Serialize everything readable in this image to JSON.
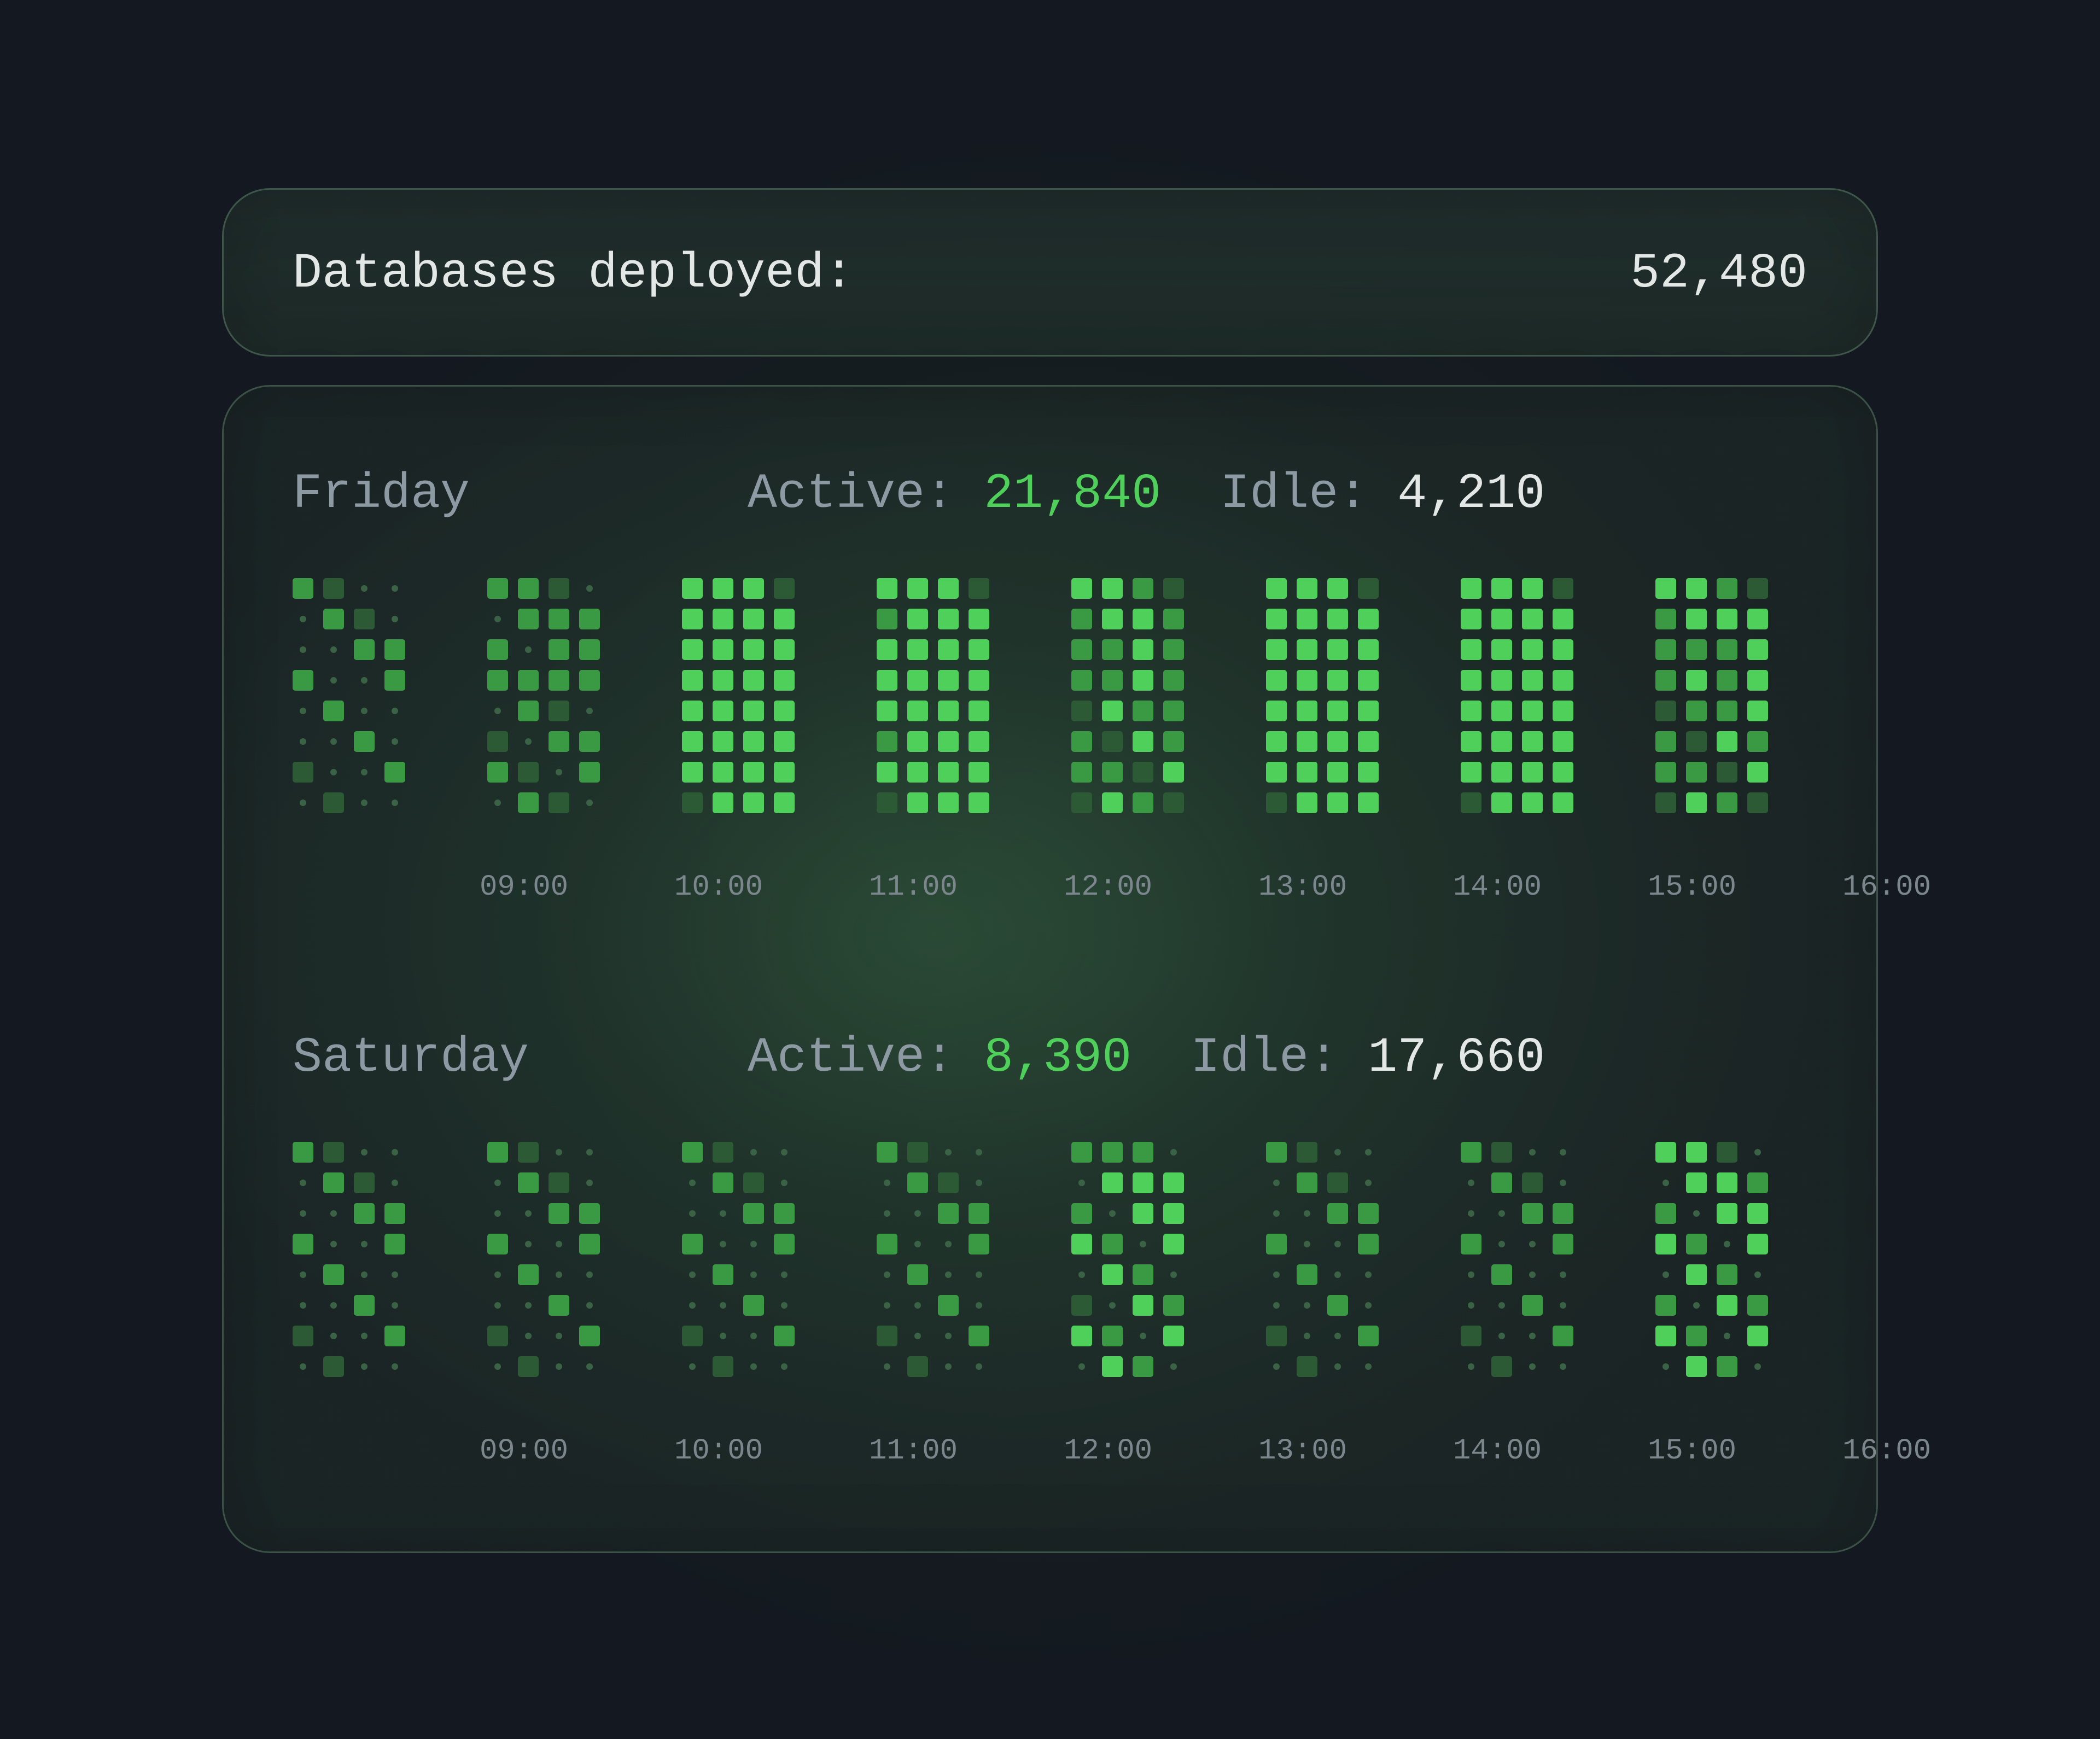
{
  "summary": {
    "label": "Databases deployed:",
    "value": "52,480"
  },
  "days": [
    {
      "name": "Friday",
      "active_label": "Active:",
      "active_value": "21,840",
      "idle_label": "Idle:",
      "idle_value": "4,210"
    },
    {
      "name": "Saturday",
      "active_label": "Active:",
      "active_value": "8,390",
      "idle_label": "Idle:",
      "idle_value": "17,660"
    }
  ],
  "time_labels": [
    "09:00",
    "10:00",
    "11:00",
    "12:00",
    "13:00",
    "14:00",
    "15:00",
    "16:00"
  ],
  "colors": {
    "bright": "#4fd05a",
    "mid": "#3a9a44",
    "dim": "#2b5a35",
    "dot": "#3a6244"
  },
  "grid_patterns": {
    "legend": "each string is one row of 4 cells; B=bright, M=mid, D=dim, .=dot",
    "friday": [
      [
        "MD..",
        ".MD.",
        "..MM",
        "M..M",
        ".M..",
        "..M.",
        "D..M",
        ".D.."
      ],
      [
        "MMD.",
        ".MMM",
        "M.MM",
        "MMMM",
        ".MD.",
        "D.MM",
        "MD.M",
        ".MD."
      ],
      [
        "BBBD",
        "BBBB",
        "BBBB",
        "BBBB",
        "BBBB",
        "BBBB",
        "BBBB",
        "DBBB"
      ],
      [
        "BBBD",
        "MBBB",
        "BBBB",
        "BBBB",
        "BBBB",
        "MBBB",
        "BBBB",
        "DBBB"
      ],
      [
        "BBMD",
        "MBBM",
        "MMBM",
        "MMBM",
        "DBMM",
        "MDBM",
        "MMDB",
        "DBMD"
      ],
      [
        "BBBD",
        "BBBB",
        "BBBB",
        "BBBB",
        "BBBB",
        "BBBB",
        "BBBB",
        "DBBB"
      ],
      [
        "BBBD",
        "BBBB",
        "BBBB",
        "BBBB",
        "BBBB",
        "BBBB",
        "BBBB",
        "DBBB"
      ],
      [
        "BBMD",
        "MBBB",
        "MMMB",
        "MBMB",
        "DMMB",
        "MDBM",
        "MMDB",
        "DBMD"
      ]
    ],
    "saturday": [
      [
        "MD..",
        ".MD.",
        "..MM",
        "M..M",
        ".M..",
        "..M.",
        "D..M",
        ".D.."
      ],
      [
        "MD..",
        ".MD.",
        "..MM",
        "M..M",
        ".M..",
        "..M.",
        "D..M",
        ".D.."
      ],
      [
        "MD..",
        ".MD.",
        "..MM",
        "M..M",
        ".M..",
        "..M.",
        "D..M",
        ".D.."
      ],
      [
        "MD..",
        ".MD.",
        "..MM",
        "M..M",
        ".M..",
        "..M.",
        "D..M",
        ".D.."
      ],
      [
        "MMM.",
        ".BBB",
        "M.BB",
        "BM.B",
        ".BM.",
        "D.BM",
        "BM.B",
        ".BM."
      ],
      [
        "MD..",
        ".MD.",
        "..MM",
        "M..M",
        ".M..",
        "..M.",
        "D..M",
        ".D.."
      ],
      [
        "MD..",
        ".MD.",
        "..MM",
        "M..M",
        ".M..",
        "..M.",
        "D..M",
        ".D.."
      ],
      [
        "BBD.",
        ".BBM",
        "M.BB",
        "BM.B",
        ".BM.",
        "M.BM",
        "BM.B",
        ".BM."
      ]
    ]
  }
}
